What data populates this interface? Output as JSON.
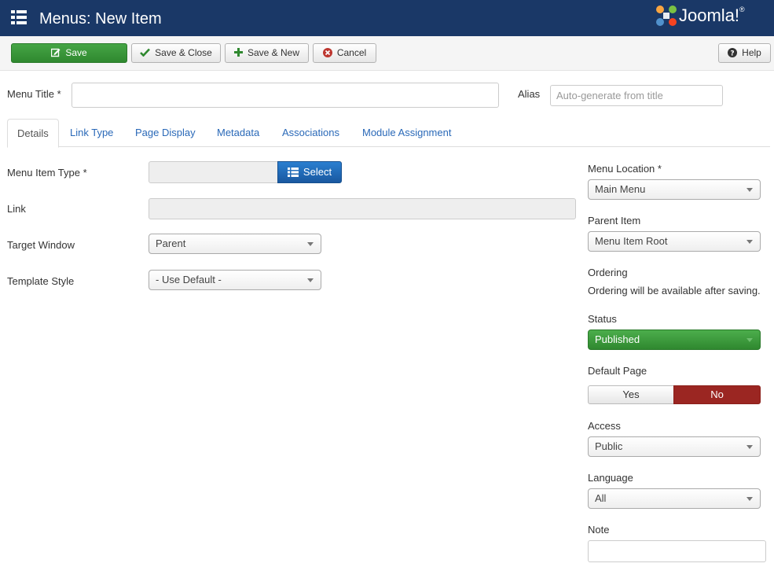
{
  "header": {
    "title": "Menus: New Item",
    "logo_text": "Joomla!",
    "logo_reg": "®"
  },
  "toolbar": {
    "save": "Save",
    "save_close": "Save & Close",
    "save_new": "Save & New",
    "cancel": "Cancel",
    "help": "Help"
  },
  "title_row": {
    "menu_title_label": "Menu Title *",
    "menu_title_value": "",
    "alias_label": "Alias",
    "alias_placeholder": "Auto-generate from title"
  },
  "tabs": [
    "Details",
    "Link Type",
    "Page Display",
    "Metadata",
    "Associations",
    "Module Assignment"
  ],
  "details": {
    "menu_item_type_label": "Menu Item Type *",
    "select_button": "Select",
    "link_label": "Link",
    "target_window_label": "Target Window",
    "target_window_value": "Parent",
    "template_style_label": "Template Style",
    "template_style_value": "- Use Default -"
  },
  "sidebar": {
    "menu_location_label": "Menu Location *",
    "menu_location_value": "Main Menu",
    "parent_item_label": "Parent Item",
    "parent_item_value": "Menu Item Root",
    "ordering_label": "Ordering",
    "ordering_text": "Ordering will be available after saving.",
    "status_label": "Status",
    "status_value": "Published",
    "default_page_label": "Default Page",
    "default_yes": "Yes",
    "default_no": "No",
    "access_label": "Access",
    "access_value": "Public",
    "language_label": "Language",
    "language_value": "All",
    "note_label": "Note"
  },
  "colors": {
    "header": "#1a3867",
    "save_green": "#46a546",
    "status_green": "#3f9b3f",
    "no_red": "#9b2622",
    "link_blue": "#2a69b8"
  }
}
